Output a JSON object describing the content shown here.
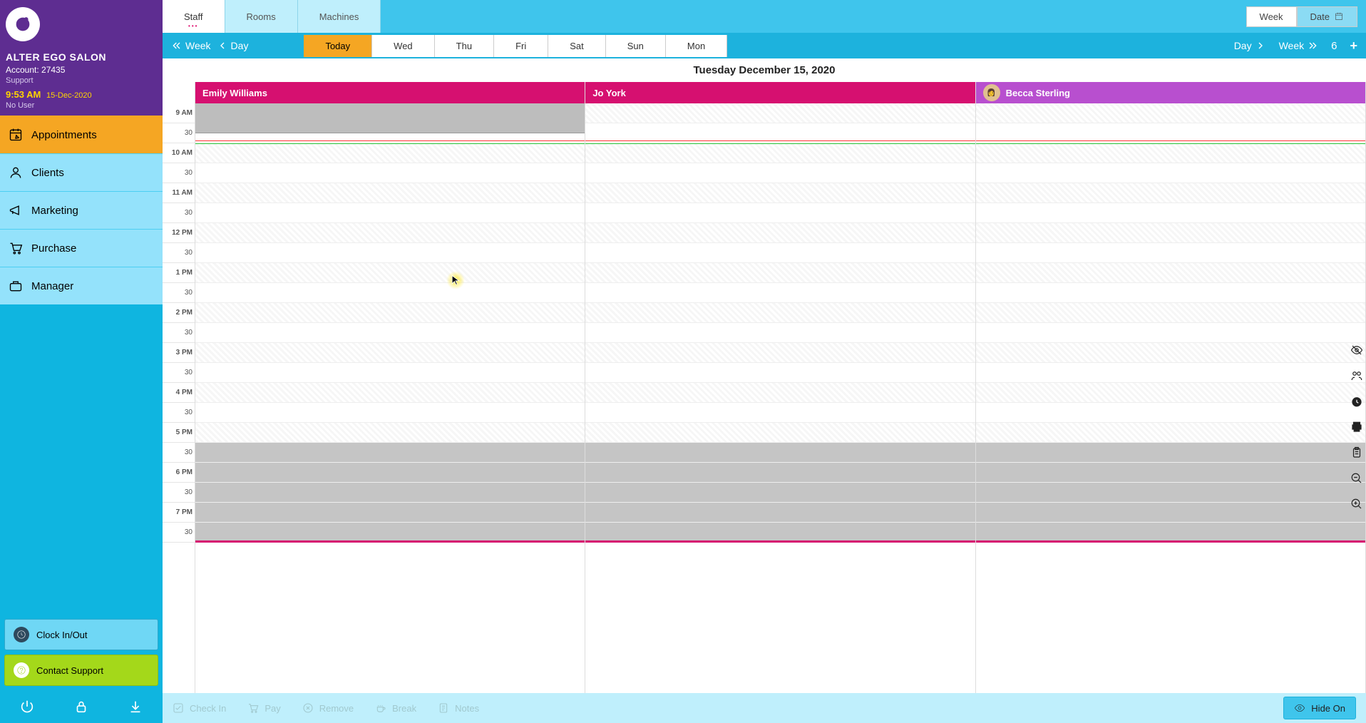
{
  "salon": {
    "name": "ALTER EGO SALON",
    "account_label": "Account: 27435",
    "support_label": "Support",
    "time": "9:53 AM",
    "date": "15-Dec-2020",
    "user": "No User"
  },
  "nav": {
    "appointments": "Appointments",
    "clients": "Clients",
    "marketing": "Marketing",
    "purchase": "Purchase",
    "manager": "Manager"
  },
  "side_buttons": {
    "clock": "Clock In/Out",
    "support": "Contact Support"
  },
  "view_tabs": {
    "staff": "Staff",
    "rooms": "Rooms",
    "machines": "Machines"
  },
  "top_right": {
    "week": "Week",
    "date": "Date"
  },
  "daybar": {
    "prev_week": "Week",
    "prev_day": "Day",
    "tabs": [
      "Today",
      "Wed",
      "Thu",
      "Fri",
      "Sat",
      "Sun",
      "Mon"
    ],
    "next_day": "Day",
    "next_week": "Week",
    "columns": "6"
  },
  "date_heading": "Tuesday December 15, 2020",
  "staff": {
    "col1": "Emily Williams",
    "col2": "Jo York",
    "col3": "Becca Sterling"
  },
  "time_labels": [
    "9 AM",
    "30",
    "10 AM",
    "30",
    "11 AM",
    "30",
    "12 PM",
    "30",
    "1 PM",
    "30",
    "2 PM",
    "30",
    "3 PM",
    "30",
    "4 PM",
    "30",
    "5 PM",
    "30",
    "6 PM",
    "30",
    "7 PM",
    "30"
  ],
  "actions": {
    "checkin": "Check In",
    "pay": "Pay",
    "remove": "Remove",
    "break": "Break",
    "notes": "Notes",
    "hide_on": "Hide On"
  }
}
